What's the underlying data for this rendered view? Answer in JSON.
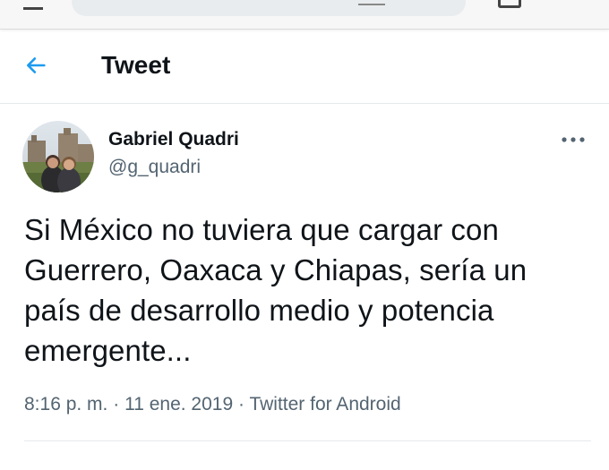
{
  "header": {
    "title": "Tweet",
    "back_icon": "arrow-left-icon",
    "accent_color": "#1d9bf0"
  },
  "tweet": {
    "author": {
      "display_name": "Gabriel Quadri",
      "handle": "@g_quadri"
    },
    "more_icon": "more-horizontal-icon",
    "text": "Si México no tuviera que cargar con Guerrero, Oaxaca y Chiapas, sería un país de desarrollo medio y potencia emergente...",
    "time": "8:16 p. m.",
    "separator": "·",
    "date": "11 ene. 2019",
    "source": "Twitter for Android"
  }
}
